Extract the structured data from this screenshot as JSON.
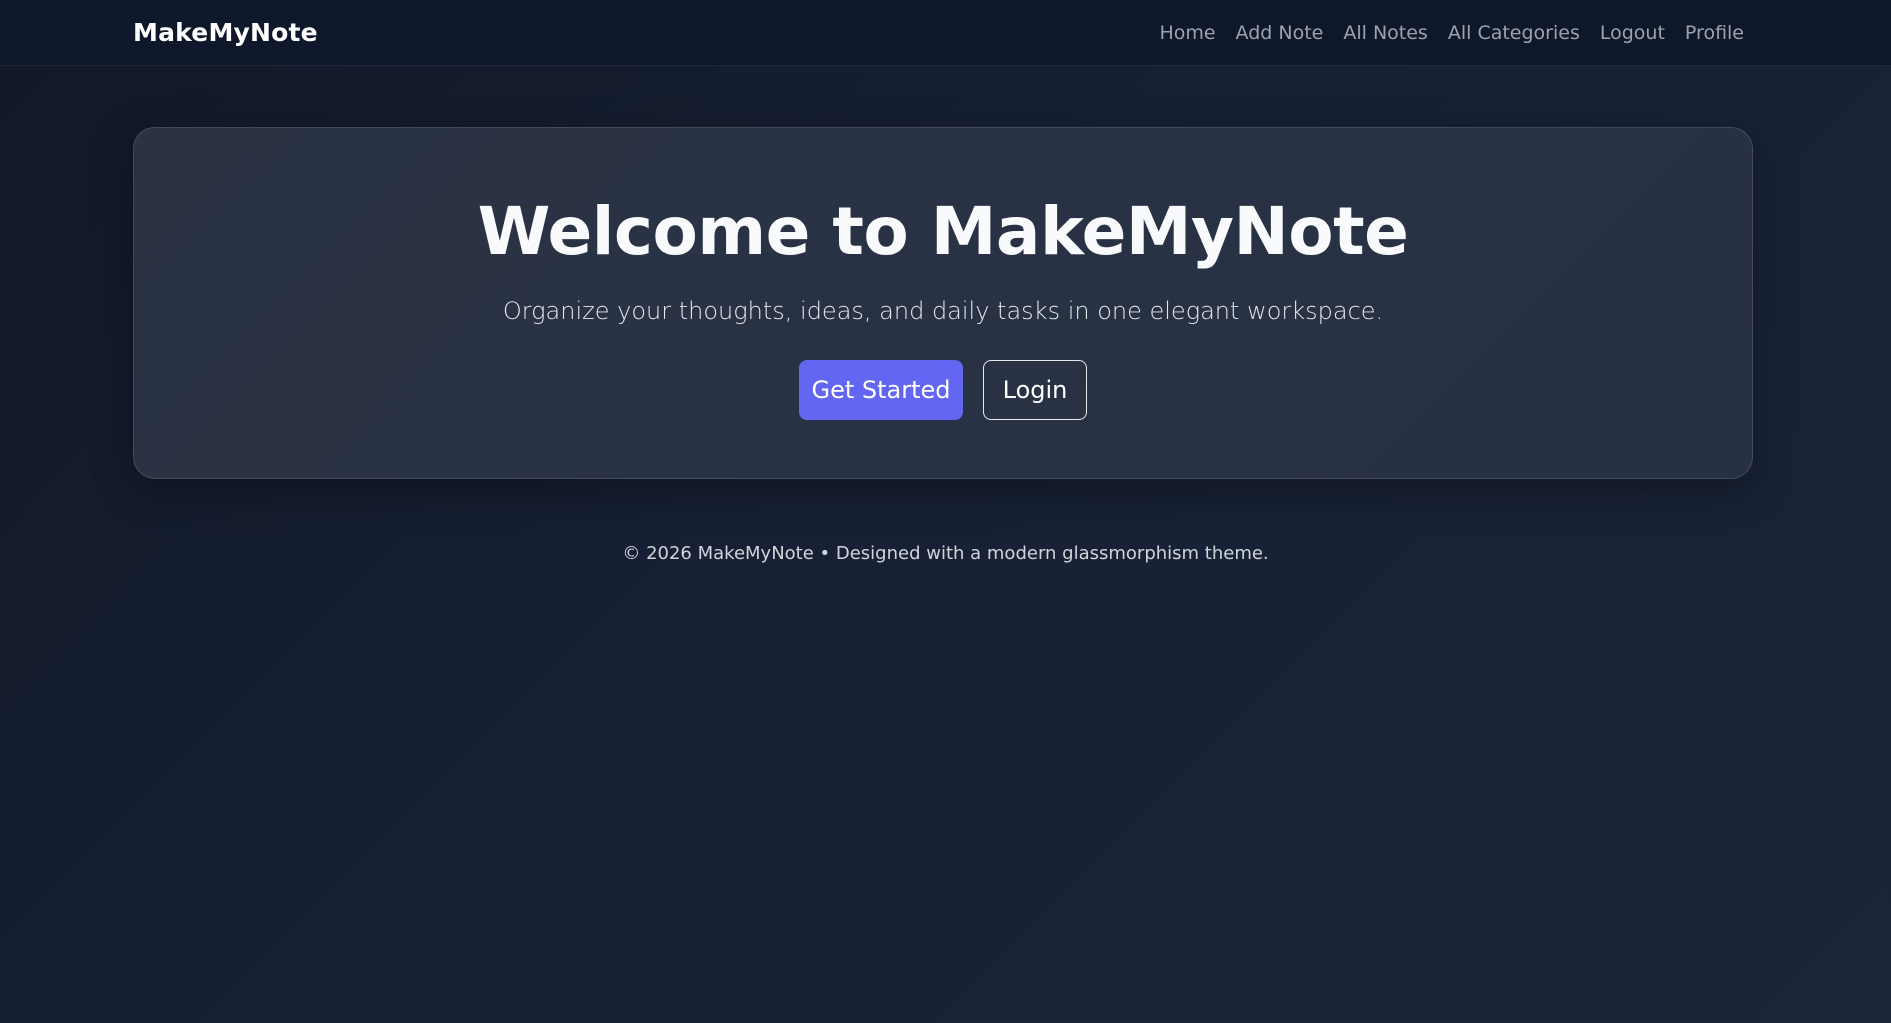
{
  "navbar": {
    "brand": "MakeMyNote",
    "links": [
      "Home",
      "Add Note",
      "All Notes",
      "All Categories",
      "Logout",
      "Profile"
    ]
  },
  "hero": {
    "title": "Welcome to MakeMyNote",
    "subtitle": "Organize your thoughts, ideas, and daily tasks in one elegant workspace.",
    "primary_button": "Get Started",
    "secondary_button": "Login"
  },
  "footer": {
    "text": "© 2026 MakeMyNote • Designed with a modern glassmorphism theme."
  },
  "colors": {
    "navbar_bg": "#0f172a",
    "primary_accent": "#6366f1",
    "nav_link": "#9ca3af"
  }
}
